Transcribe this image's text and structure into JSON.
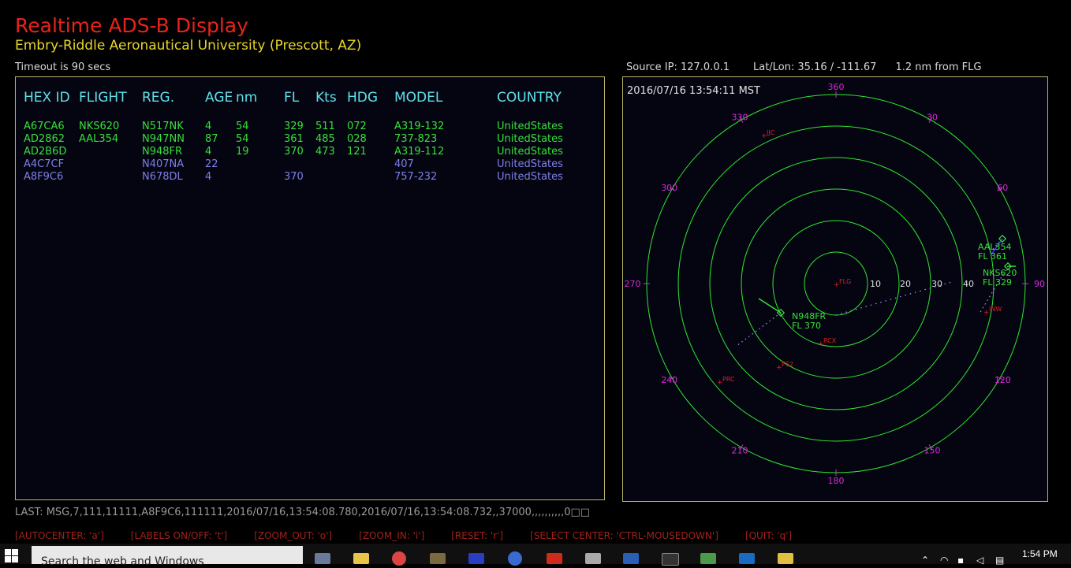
{
  "header": {
    "title": "Realtime ADS-B Display",
    "subtitle": "Embry-Riddle Aeronautical University  (Prescott, AZ)",
    "timeout": "Timeout is 90 secs",
    "source_ip": "Source IP: 127.0.0.1",
    "latlon": "Lat/Lon:   35.16 / -111.67",
    "nm_from": "1.2 nm from  FLG"
  },
  "table": {
    "columns": [
      "HEX ID",
      "FLIGHT",
      "REG.",
      "AGE",
      "nm",
      "FL",
      "Kts",
      "HDG",
      "MODEL",
      "COUNTRY"
    ],
    "rows": [
      {
        "hex": "A67CA6",
        "flight": "NKS620",
        "reg": "N517NK",
        "age": "4",
        "nm": "54",
        "fl": "329",
        "kts": "511",
        "hdg": "072",
        "model": "A319-132",
        "country": "UnitedStates",
        "status": "active"
      },
      {
        "hex": "AD2862",
        "flight": "AAL354",
        "reg": "N947NN",
        "age": "87",
        "nm": "54",
        "fl": "361",
        "kts": "485",
        "hdg": "028",
        "model": "737-823",
        "country": "UnitedStates",
        "status": "active"
      },
      {
        "hex": "AD2B6D",
        "flight": "",
        "reg": "N948FR",
        "age": "4",
        "nm": "19",
        "fl": "370",
        "kts": "473",
        "hdg": "121",
        "model": "A319-112",
        "country": "UnitedStates",
        "status": "active"
      },
      {
        "hex": "A4C7CF",
        "flight": "",
        "reg": "N407NA",
        "age": "22",
        "nm": "",
        "fl": "",
        "kts": "",
        "hdg": "",
        "model": "407",
        "country": "UnitedStates",
        "status": "stale"
      },
      {
        "hex": "A8F9C6",
        "flight": "",
        "reg": "N678DL",
        "age": "4",
        "nm": "",
        "fl": "370",
        "kts": "",
        "hdg": "",
        "model": "757-232",
        "country": "UnitedStates",
        "status": "stale"
      }
    ]
  },
  "radar": {
    "datetime": "2016/07/16    13:54:11 MST",
    "range_labels": [
      "10",
      "20",
      "30",
      "40"
    ],
    "bearing_labels": [
      "360",
      "30",
      "60",
      "90",
      "120",
      "150",
      "180",
      "210",
      "240",
      "270",
      "300",
      "330"
    ],
    "waypoints": [
      "FLG",
      "JJC",
      "INW",
      "RCX",
      "PS2",
      "PRC"
    ],
    "aircraft": [
      {
        "callsign": "AAL354",
        "fl": "FL 361"
      },
      {
        "callsign": "NKS620",
        "fl": "FL 329"
      },
      {
        "callsign": "N948FR",
        "fl": "FL 370"
      }
    ]
  },
  "status": {
    "last_msg": "LAST: MSG,7,111,11111,A8F9C6,111111,2016/07/16,13:54:08.780,2016/07/16,13:54:08.732,,37000,,,,,,,,,,0□□",
    "shortcuts": [
      "[AUTOCENTER: 'a']",
      "[LABELS ON/OFF: 't']",
      "[ZOOM_OUT:  'o']",
      "[ZOOM_IN:  'i']",
      "[RESET:  'r']",
      "[SELECT CENTER: 'CTRL-MOUSEDOWN']",
      "[QUIT:  'q']"
    ]
  },
  "taskbar": {
    "search_placeholder": "Search the web and Windows",
    "clock": "1:54 PM"
  },
  "colors": {
    "title": "#e8231b",
    "subtitle": "#e8d62a",
    "header_cyan": "#5fe2ea",
    "active_green": "#36e036",
    "stale_purple": "#7d7fe6",
    "ring_green": "#2ee82e",
    "bearing_magenta": "#d62ad6",
    "waypoint_red": "#e02020"
  }
}
